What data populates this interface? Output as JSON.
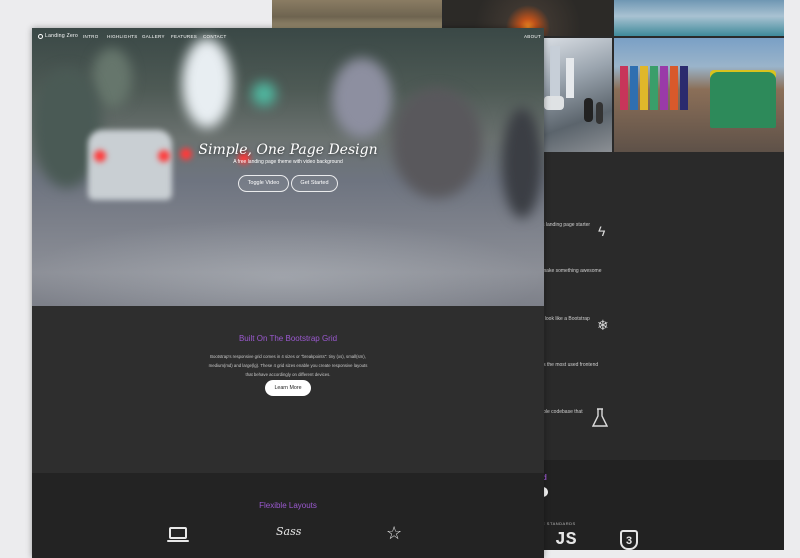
{
  "nav": {
    "brand": "Landing Zero",
    "links": [
      "INTRO",
      "HIGHLIGHTS",
      "GALLERY",
      "FEATURES",
      "CONTACT"
    ],
    "right_link": "ABOUT"
  },
  "hero": {
    "title": "Simple, One Page Design",
    "subtitle": "A free landing page theme with video background",
    "toggle_video": "Toggle Video",
    "get_started": "Get Started"
  },
  "grid_section": {
    "title": "Built On The Bootstrap Grid",
    "body": "Bootstrap's responsive grid comes in 4 sizes or \"breakpoints\": tiny (xs), small(sm), medium(md) and large(lg). These 4 grid sizes enable you create responsive layouts that behave accordingly on different devices.",
    "button": "Learn More"
  },
  "flex_section": {
    "title": "Flexible Layouts",
    "icons": [
      "laptop-icon",
      "sass-icon",
      "star-icon"
    ]
  },
  "back_page": {
    "features": [
      {
        "text": "s landing page starter",
        "icon": "bolt-icon"
      },
      {
        "text": "make something awesome",
        "icon": ""
      },
      {
        "text": "t look like a Bootstrap",
        "icon": "snowflake-icon"
      },
      {
        "text": "is the most used frontend",
        "icon": ""
      },
      {
        "text": "ible codebase that",
        "icon": "flask-icon"
      }
    ],
    "bottom_lead": "d",
    "standards": "E STANDARDS",
    "js_label": "JS",
    "css_label": "3"
  },
  "colors": {
    "accent": "#9b59d0",
    "dark_bg": "#2e2e2e",
    "darker_bg": "#232323"
  }
}
